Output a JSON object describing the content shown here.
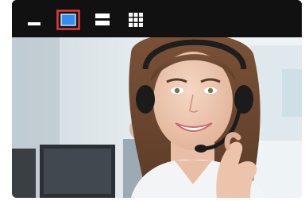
{
  "toolbar": {
    "buttons": [
      {
        "id": "minimize",
        "icon": "minimize-icon",
        "selected": false
      },
      {
        "id": "single-view",
        "icon": "single-view-icon",
        "selected": true
      },
      {
        "id": "two-row-view",
        "icon": "two-row-layout-icon",
        "selected": false
      },
      {
        "id": "grid-view",
        "icon": "grid-layout-icon",
        "selected": false
      }
    ],
    "accent_selected": "#e33b3b",
    "accent_fill": "#2f8ef0"
  },
  "video": {
    "subject": "customer-support-agent-with-headset"
  }
}
